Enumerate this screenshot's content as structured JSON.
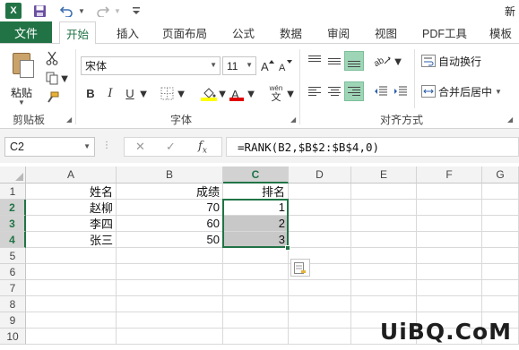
{
  "app": {
    "logo": "X",
    "title_fragment": "新"
  },
  "tabs": [
    {
      "label": "文件"
    },
    {
      "label": "开始"
    },
    {
      "label": "插入"
    },
    {
      "label": "页面布局"
    },
    {
      "label": "公式"
    },
    {
      "label": "数据"
    },
    {
      "label": "审阅"
    },
    {
      "label": "视图"
    },
    {
      "label": "PDF工具"
    },
    {
      "label": "模板"
    }
  ],
  "ribbon": {
    "clipboard": {
      "paste_label": "粘贴",
      "group_label": "剪贴板"
    },
    "font": {
      "font_name": "宋体",
      "font_size": "11",
      "bold": "B",
      "italic": "I",
      "underline": "U",
      "wen": "wén",
      "wen_char": "文",
      "group_label": "字体",
      "fill_color": "#ffff00",
      "font_color": "#e00000"
    },
    "alignment": {
      "wrap_text": "自动换行",
      "merge_center": "合并后居中",
      "group_label": "对齐方式"
    }
  },
  "formula_bar": {
    "name_box": "C2",
    "formula": "=RANK(B2,$B$2:$B$4,0)"
  },
  "grid": {
    "columns": [
      "A",
      "B",
      "C",
      "D",
      "E",
      "F",
      "G"
    ],
    "rows": [
      "1",
      "2",
      "3",
      "4",
      "5",
      "6",
      "7",
      "8",
      "9",
      "10"
    ],
    "cells": {
      "A1": "姓名",
      "B1": "成绩",
      "C1": "排名",
      "A2": "赵柳",
      "B2": "70",
      "C2": "1",
      "A3": "李四",
      "B3": "60",
      "C3": "2",
      "A4": "张三",
      "B4": "50",
      "C4": "3"
    },
    "selection": "C2:C4",
    "active_cell": "C2"
  },
  "watermark": "UiBQ.CoM",
  "colors": {
    "accent": "#217346",
    "selection_fill": "#c8c8c8"
  }
}
